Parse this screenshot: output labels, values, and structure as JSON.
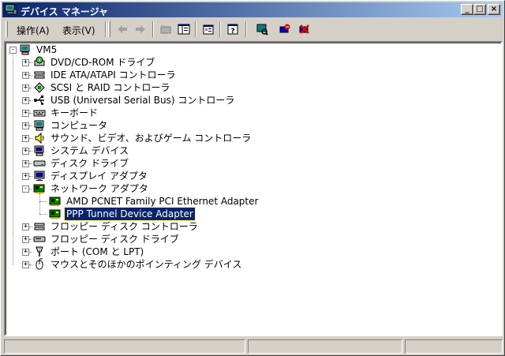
{
  "window": {
    "title": "デバイス マネージャ"
  },
  "titlebar_buttons": {
    "minimize": "_",
    "maximize": "□",
    "close": "×"
  },
  "menu": [
    {
      "label": "操作(A)"
    },
    {
      "label": "表示(V)"
    }
  ],
  "toolbar_icons": [
    "back-arrow-icon",
    "forward-arrow-icon",
    "up-folder-icon",
    "show-hide-tree-icon",
    "properties-icon",
    "help-icon",
    "scan-hardware-icon",
    "disable-device-icon",
    "uninstall-device-icon"
  ],
  "tree": {
    "root": "VM5",
    "items": [
      {
        "label": "DVD/CD-ROM ドライブ",
        "icon": "cdrom-icon",
        "expander": "+"
      },
      {
        "label": "IDE ATA/ATAPI コントローラ",
        "icon": "ide-controller-icon",
        "expander": "+"
      },
      {
        "label": "SCSI と RAID コントローラ",
        "icon": "scsi-controller-icon",
        "expander": "+"
      },
      {
        "label": "USB (Universal Serial Bus) コントローラ",
        "icon": "usb-icon",
        "expander": "+"
      },
      {
        "label": "キーボード",
        "icon": "keyboard-icon",
        "expander": "+"
      },
      {
        "label": "コンピュータ",
        "icon": "computer-icon",
        "expander": "+"
      },
      {
        "label": "サウンド、ビデオ、およびゲーム コントローラ",
        "icon": "sound-icon",
        "expander": "+"
      },
      {
        "label": "システム デバイス",
        "icon": "system-device-icon",
        "expander": "+"
      },
      {
        "label": "ディスク ドライブ",
        "icon": "disk-drive-icon",
        "expander": "+"
      },
      {
        "label": "ディスプレイ アダプタ",
        "icon": "display-adapter-icon",
        "expander": "+"
      },
      {
        "label": "ネットワーク アダプタ",
        "icon": "network-adapter-icon",
        "expander": "-",
        "children": [
          {
            "label": "AMD PCNET Family PCI Ethernet Adapter",
            "icon": "network-card-icon"
          },
          {
            "label": "PPP Tunnel Device Adapter",
            "icon": "network-card-icon",
            "selected": true
          }
        ]
      },
      {
        "label": "フロッピー ディスク コントローラ",
        "icon": "floppy-controller-icon",
        "expander": "+"
      },
      {
        "label": "フロッピー ディスク ドライブ",
        "icon": "floppy-drive-icon",
        "expander": "+"
      },
      {
        "label": "ポート (COM と LPT)",
        "icon": "port-icon",
        "expander": "+"
      },
      {
        "label": "マウスとそのほかのポインティング デバイス",
        "icon": "mouse-icon",
        "expander": "+"
      }
    ]
  },
  "colors": {
    "selection": "#0a246a",
    "title_start": "#0a246a",
    "title_end": "#a6caf0",
    "face": "#d4d0c8"
  }
}
